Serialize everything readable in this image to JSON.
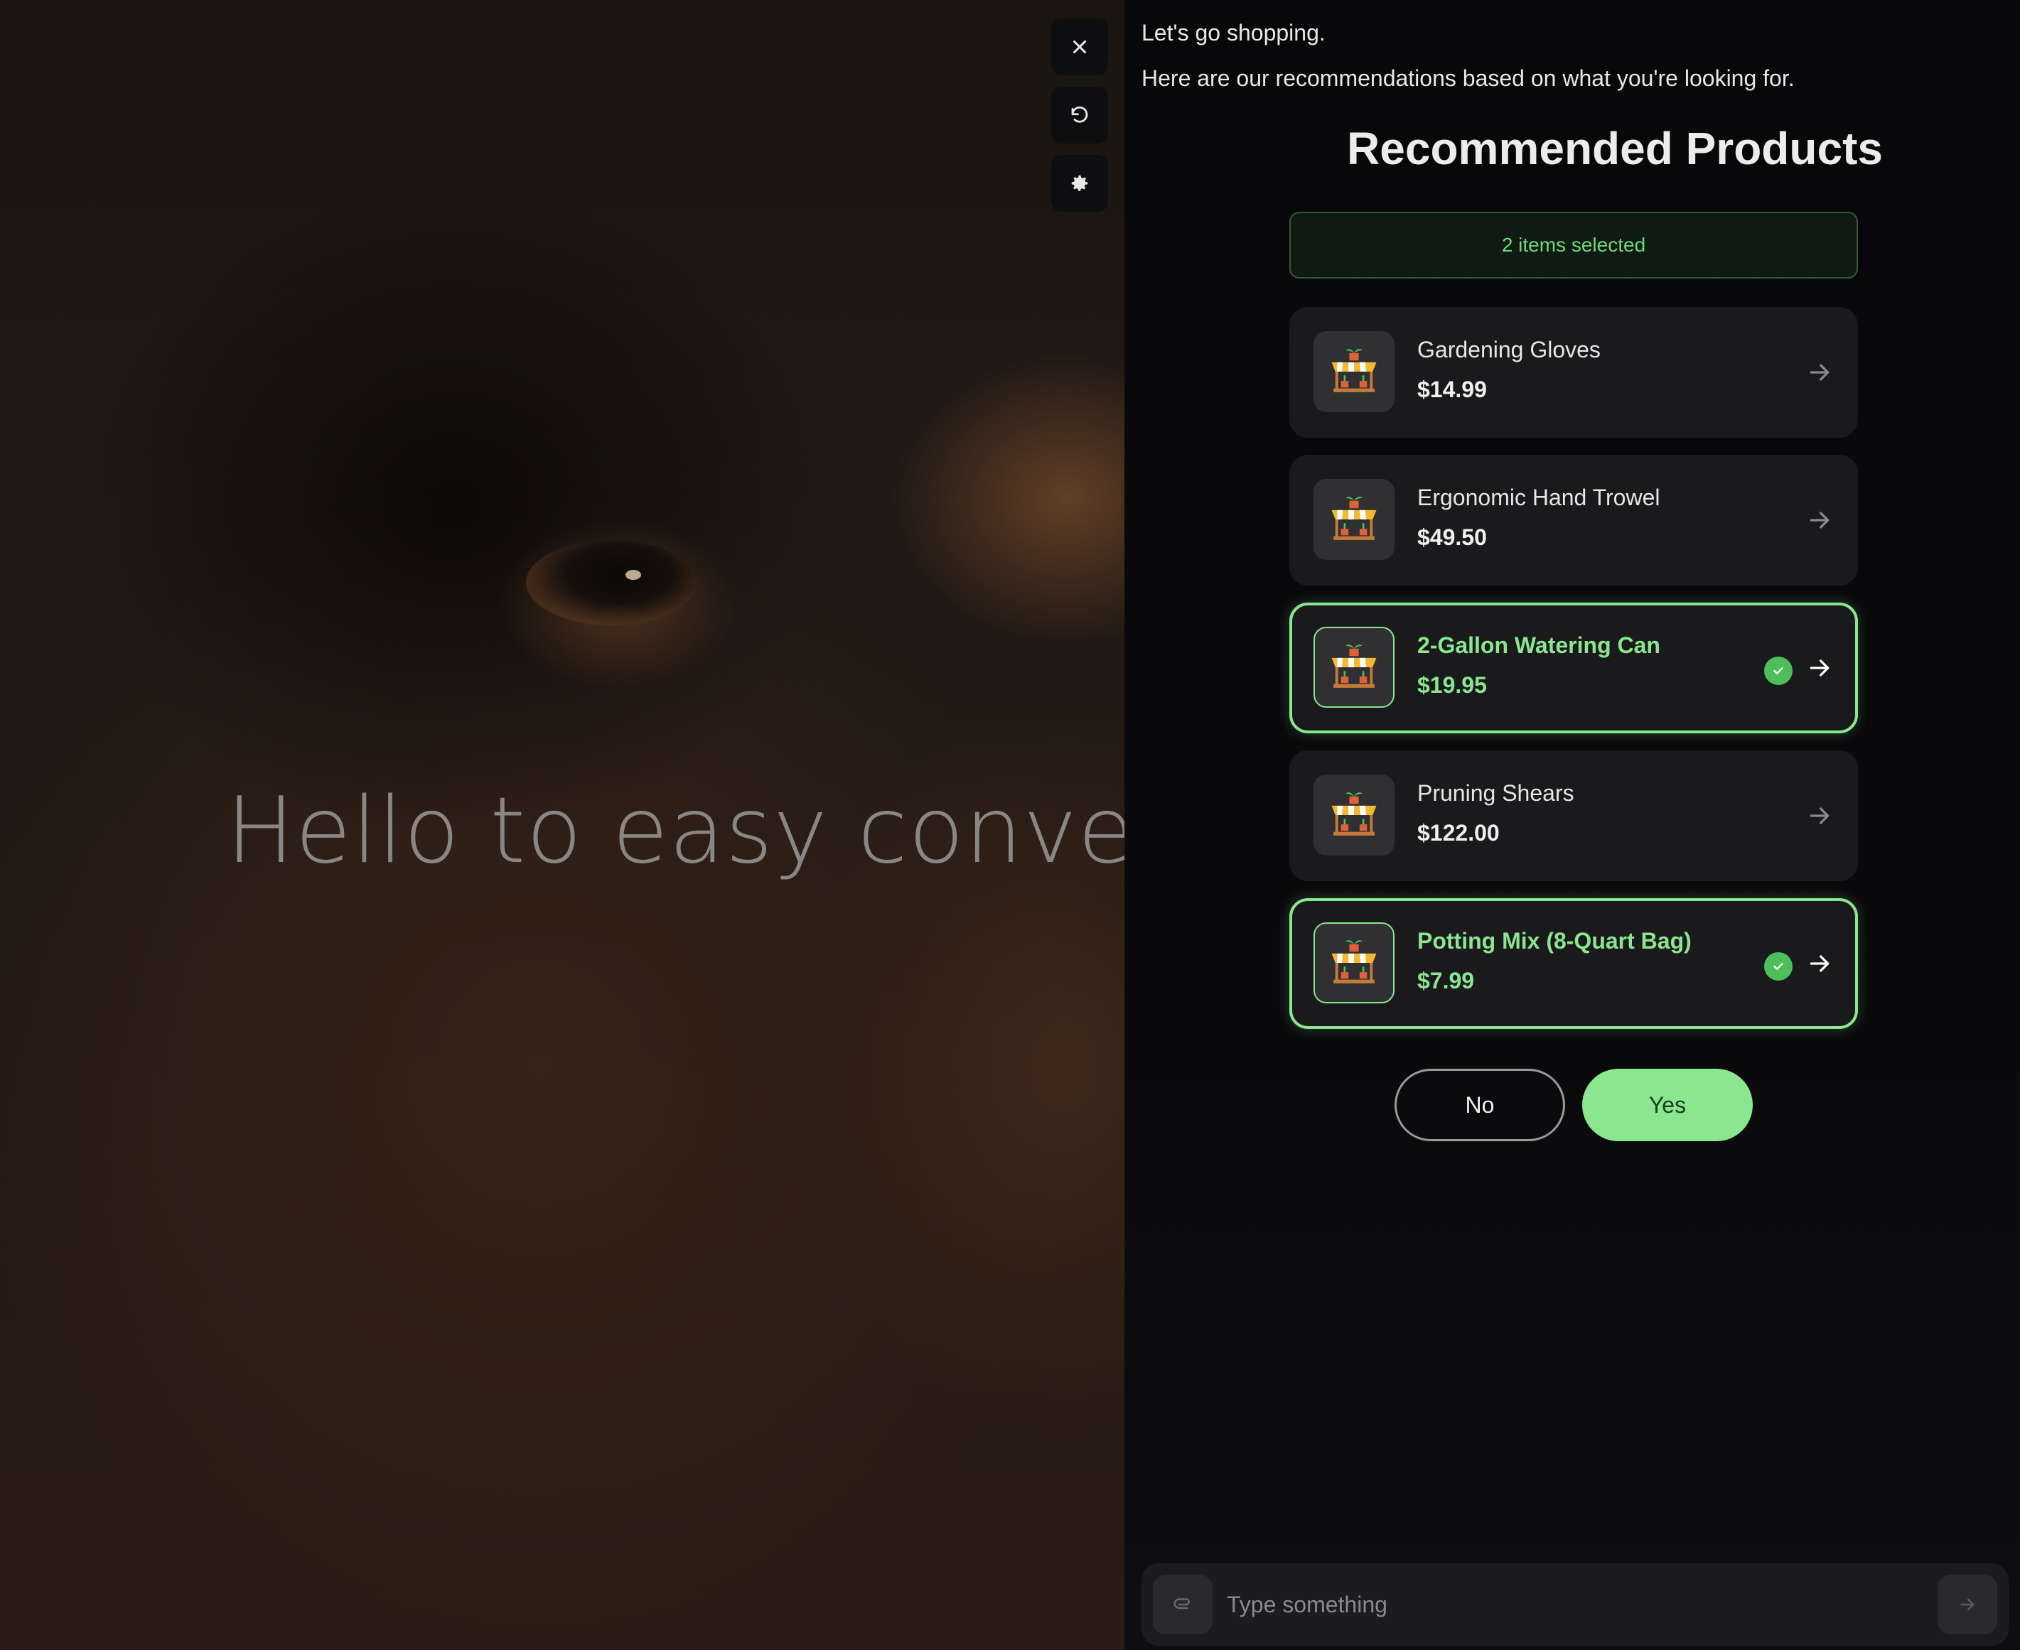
{
  "hero": {
    "title": "Hello to easy conversati"
  },
  "tools": {
    "close_icon": "close-icon",
    "refresh_icon": "refresh-icon",
    "settings_icon": "gear-icon"
  },
  "chat": {
    "message_1": "Let's go shopping.",
    "message_2": "Here are our recommendations based on what you're looking for."
  },
  "recommendations": {
    "title": "Recommended Products",
    "selected_count": "2 items selected",
    "products": [
      {
        "name": "Gardening Gloves",
        "price": "$14.99",
        "selected": false,
        "icon": "garden-shop-icon"
      },
      {
        "name": "Ergonomic Hand Trowel",
        "price": "$49.50",
        "selected": false,
        "icon": "garden-shop-icon"
      },
      {
        "name": "2-Gallon Watering Can",
        "price": "$19.95",
        "selected": true,
        "icon": "garden-shop-icon"
      },
      {
        "name": "Pruning Shears",
        "price": "$122.00",
        "selected": false,
        "icon": "garden-shop-icon"
      },
      {
        "name": "Potting Mix (8-Quart Bag)",
        "price": "$7.99",
        "selected": true,
        "icon": "garden-shop-icon"
      }
    ]
  },
  "actions": {
    "no_label": "No",
    "yes_label": "Yes"
  },
  "composer": {
    "placeholder": "Type something"
  },
  "colors": {
    "accent": "#8ae68f",
    "check": "#4cbf5a",
    "panel_bg": "#0a0a0c",
    "card_bg": "#1a1a1d"
  }
}
